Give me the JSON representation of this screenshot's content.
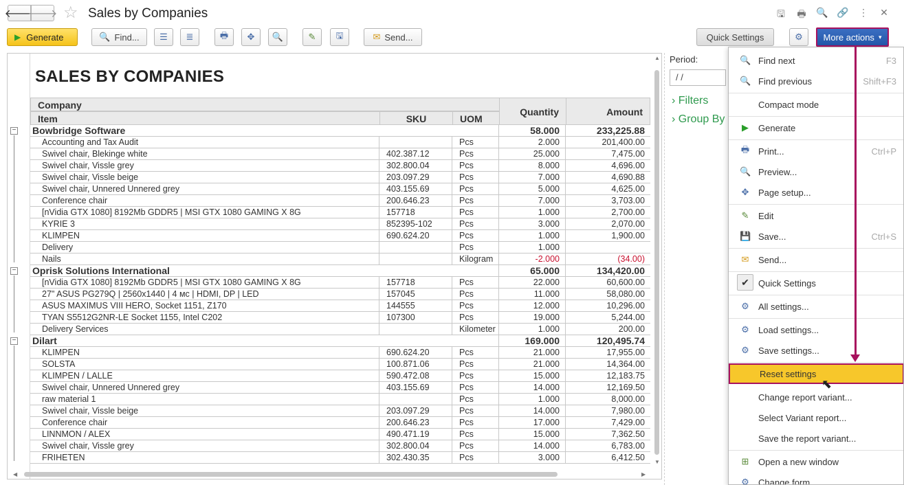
{
  "window": {
    "title": "Sales by Companies",
    "icons": [
      "save-icon",
      "print-icon",
      "preview-icon",
      "link-icon",
      "more-vertical-icon",
      "close-icon"
    ]
  },
  "toolbar": {
    "generate_label": "Generate",
    "find_label": "Find...",
    "send_label": "Send...",
    "quick_settings_label": "Quick Settings",
    "more_actions_label": "More actions"
  },
  "report": {
    "title": "SALES BY COMPANIES",
    "headers": {
      "company": "Company",
      "item": "Item",
      "sku": "SKU",
      "uom": "UOM",
      "quantity": "Quantity",
      "amount": "Amount"
    },
    "groups": [
      {
        "name": "Bowbridge Software",
        "quantity": "58.000",
        "amount": "233,225.88",
        "items": [
          {
            "name": "Accounting and Tax Audit",
            "sku": "",
            "uom": "Pcs",
            "quantity": "2.000",
            "amount": "201,400.00"
          },
          {
            "name": "Swivel chair, Blekinge white",
            "sku": "402.387.12",
            "uom": "Pcs",
            "quantity": "25.000",
            "amount": "7,475.00"
          },
          {
            "name": "Swivel chair, Vissle grey",
            "sku": "302.800.04",
            "uom": "Pcs",
            "quantity": "8.000",
            "amount": "4,696.00"
          },
          {
            "name": "Swivel chair, Vissle beige",
            "sku": "203.097.29",
            "uom": "Pcs",
            "quantity": "7.000",
            "amount": "4,690.88"
          },
          {
            "name": "Swivel chair, Unnered Unnered grey",
            "sku": "403.155.69",
            "uom": "Pcs",
            "quantity": "5.000",
            "amount": "4,625.00"
          },
          {
            "name": "Conference chair",
            "sku": "200.646.23",
            "uom": "Pcs",
            "quantity": "7.000",
            "amount": "3,703.00"
          },
          {
            "name": "[nVidia GTX 1080] 8192Mb GDDR5 | MSI GTX 1080 GAMING X 8G",
            "sku": "157718",
            "uom": "Pcs",
            "quantity": "1.000",
            "amount": "2,700.00"
          },
          {
            "name": "KYRIE 3",
            "sku": "852395-102",
            "uom": "Pcs",
            "quantity": "3.000",
            "amount": "2,070.00"
          },
          {
            "name": "KLIMPEN",
            "sku": " 690.624.20",
            "uom": "Pcs",
            "quantity": "1.000",
            "amount": "1,900.00"
          },
          {
            "name": "Delivery",
            "sku": "",
            "uom": "Pcs",
            "quantity": "1.000",
            "amount": ""
          },
          {
            "name": "Nails",
            "sku": "",
            "uom": "Kilogram",
            "quantity": "-2.000",
            "amount": "(34.00)",
            "negative": true
          }
        ]
      },
      {
        "name": "Oprisk Solutions International",
        "quantity": "65.000",
        "amount": "134,420.00",
        "items": [
          {
            "name": "[nVidia GTX 1080] 8192Mb GDDR5 | MSI GTX 1080 GAMING X 8G",
            "sku": "157718",
            "uom": "Pcs",
            "quantity": "22.000",
            "amount": "60,600.00"
          },
          {
            "name": "27\" ASUS PG279Q | 2560x1440 | 4 мс | HDMI, DP | LED",
            "sku": "157045",
            "uom": "Pcs",
            "quantity": "11.000",
            "amount": "58,080.00"
          },
          {
            "name": "ASUS MAXIMUS VIII HERO, Socket 1151, Z170",
            "sku": "144555",
            "uom": "Pcs",
            "quantity": "12.000",
            "amount": "10,296.00"
          },
          {
            "name": "TYAN S5512G2NR-LE Socket 1155, Intel C202",
            "sku": "107300",
            "uom": "Pcs",
            "quantity": "19.000",
            "amount": "5,244.00"
          },
          {
            "name": "Delivery Services",
            "sku": "",
            "uom": "Kilometer",
            "quantity": "1.000",
            "amount": "200.00"
          }
        ]
      },
      {
        "name": "Dilart",
        "quantity": "169.000",
        "amount": "120,495.74",
        "items": [
          {
            "name": "KLIMPEN",
            "sku": " 690.624.20",
            "uom": "Pcs",
            "quantity": "21.000",
            "amount": "17,955.00"
          },
          {
            "name": "SOLSTA",
            "sku": " 100.871.06",
            "uom": "Pcs",
            "quantity": "21.000",
            "amount": "14,364.00"
          },
          {
            "name": "KLIMPEN / LALLE",
            "sku": " 590.472.08",
            "uom": "Pcs",
            "quantity": "15.000",
            "amount": "12,183.75"
          },
          {
            "name": "Swivel chair, Unnered Unnered grey",
            "sku": "403.155.69",
            "uom": "Pcs",
            "quantity": "14.000",
            "amount": "12,169.50"
          },
          {
            "name": "raw material 1",
            "sku": "",
            "uom": "Pcs",
            "quantity": "1.000",
            "amount": "8,000.00"
          },
          {
            "name": "Swivel chair, Vissle beige",
            "sku": "203.097.29",
            "uom": "Pcs",
            "quantity": "14.000",
            "amount": "7,980.00"
          },
          {
            "name": "Conference chair",
            "sku": "200.646.23",
            "uom": "Pcs",
            "quantity": "17.000",
            "amount": "7,429.00"
          },
          {
            "name": "LINNMON / ALEX",
            "sku": " 490.471.19",
            "uom": "Pcs",
            "quantity": "15.000",
            "amount": "7,362.50"
          },
          {
            "name": "Swivel chair, Vissle grey",
            "sku": "302.800.04",
            "uom": "Pcs",
            "quantity": "14.000",
            "amount": "6,783.00"
          },
          {
            "name": "FRIHETEN",
            "sku": " 302.430.35",
            "uom": "Pcs",
            "quantity": "3.000",
            "amount": "6,412.50"
          }
        ]
      }
    ]
  },
  "settings_panel": {
    "period_label": "Period:",
    "period_value": " /  /",
    "filters_label": "Filters",
    "group_by_label": "Group By"
  },
  "menu": {
    "items": [
      {
        "label": "Find next",
        "shortcut": "F3",
        "icon": "find-next-icon",
        "glyph": "🔍"
      },
      {
        "label": "Find previous",
        "shortcut": "Shift+F3",
        "icon": "find-previous-icon",
        "glyph": "🔍"
      },
      {
        "label": "Compact mode",
        "shortcut": "",
        "icon": "",
        "glyph": ""
      },
      {
        "label": "Generate",
        "shortcut": "",
        "icon": "play-icon",
        "glyph": "▶"
      },
      {
        "label": "Print...",
        "shortcut": "Ctrl+P",
        "icon": "print-icon",
        "glyph": "🖶"
      },
      {
        "label": "Preview...",
        "shortcut": "",
        "icon": "preview-icon",
        "glyph": "🔍"
      },
      {
        "label": "Page setup...",
        "shortcut": "",
        "icon": "page-setup-icon",
        "glyph": "✥"
      },
      {
        "label": "Edit",
        "shortcut": "",
        "icon": "edit-icon",
        "glyph": "✎"
      },
      {
        "label": "Save...",
        "shortcut": "Ctrl+S",
        "icon": "save-icon",
        "glyph": "💾"
      },
      {
        "label": "Send...",
        "shortcut": "",
        "icon": "envelope-icon",
        "glyph": "✉"
      },
      {
        "label": "Quick Settings",
        "shortcut": "",
        "icon": "check-icon",
        "glyph": "✔"
      },
      {
        "label": "All settings...",
        "shortcut": "",
        "icon": "settings-icon",
        "glyph": "⚙"
      },
      {
        "label": "Load settings...",
        "shortcut": "",
        "icon": "load-settings-icon",
        "glyph": "⚙"
      },
      {
        "label": "Save settings...",
        "shortcut": "",
        "icon": "save-settings-icon",
        "glyph": "⚙"
      },
      {
        "label": "Reset settings",
        "shortcut": "",
        "icon": "",
        "glyph": ""
      },
      {
        "label": "Change report variant...",
        "shortcut": "",
        "icon": "",
        "glyph": ""
      },
      {
        "label": "Select Variant report...",
        "shortcut": "",
        "icon": "",
        "glyph": ""
      },
      {
        "label": "Save the report variant...",
        "shortcut": "",
        "icon": "",
        "glyph": ""
      },
      {
        "label": "Open a new window",
        "shortcut": "",
        "icon": "new-window-icon",
        "glyph": "⊞"
      },
      {
        "label": "Change form...",
        "shortcut": "",
        "icon": "change-form-icon",
        "glyph": "⚙"
      }
    ],
    "highlighted": "Reset settings"
  },
  "colors": {
    "accent": "#2356a8",
    "generate": "#f5c31a",
    "highlight": "#f7c72b",
    "annotation": "#a8125e",
    "link": "#2f9a4e",
    "negative": "#c8102e"
  }
}
